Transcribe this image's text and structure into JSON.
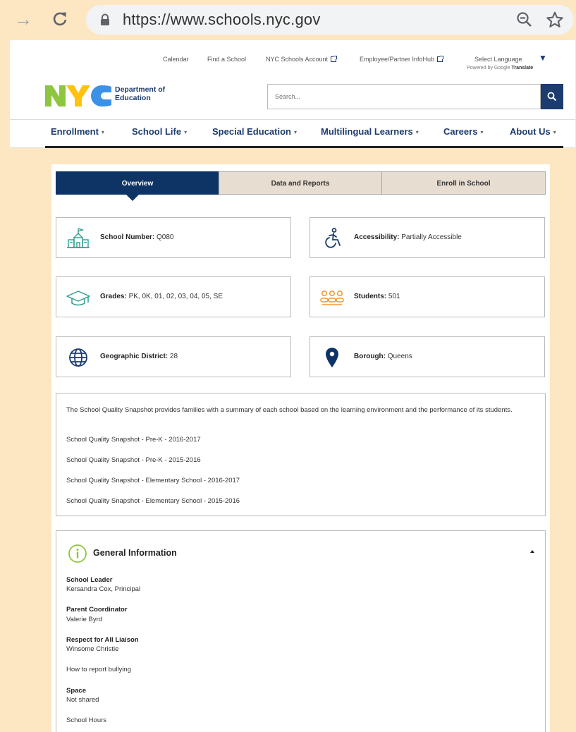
{
  "browser": {
    "url": "https://www.schools.nyc.gov",
    "back_icon": "arrow-right-icon",
    "reload_icon": "reload-icon",
    "lock_icon": "lock-icon",
    "zoom_icon": "zoom-out-icon",
    "star_icon": "star-icon"
  },
  "header": {
    "utility_links": [
      "Calendar",
      "Find a School",
      "NYC Schools Account",
      "Employee/Partner InfoHub",
      "Select Language"
    ],
    "powered_by": "Powered by",
    "google": "Google",
    "translate": "Translate",
    "logo_text": "NYC",
    "logo_dept": "Department of",
    "logo_edu": "Education",
    "search_placeholder": "Search...",
    "colors": {
      "nyc_green": "#8ec63f",
      "nyc_yellow": "#ffc20e",
      "nyc_blue": "#3c91e6",
      "navy": "#1d3c6e"
    }
  },
  "nav": {
    "items": [
      "Enrollment",
      "School Life",
      "Special Education",
      "Multilingual Learners",
      "Careers",
      "About Us"
    ]
  },
  "tabs": [
    "Overview",
    "Data and Reports",
    "Enroll in School"
  ],
  "cards": [
    {
      "label": "School Number:",
      "value": "Q080",
      "icon": "school-building-icon"
    },
    {
      "label": "Accessibility:",
      "value": "Partially Accessible",
      "icon": "wheelchair-icon"
    },
    {
      "label": "Grades:",
      "value": "PK, 0K, 01, 02, 03, 04, 05, SE",
      "icon": "graduation-cap-icon"
    },
    {
      "label": "Students:",
      "value": "501",
      "icon": "students-icon"
    },
    {
      "label": "Geographic District:",
      "value": "28",
      "icon": "globe-icon"
    },
    {
      "label": "Borough:",
      "value": "Queens",
      "icon": "map-pin-icon"
    }
  ],
  "snapshot": {
    "description": "The School Quality Snapshot provides families with a summary of each school based on the learning environment and the performance of its students.",
    "links": [
      "School Quality Snapshot - Pre-K - 2016-2017",
      "School Quality Snapshot - Pre-K - 2015-2016",
      "School Quality Snapshot - Elementary School - 2016-2017",
      "School Quality Snapshot - Elementary School - 2015-2016"
    ]
  },
  "general": {
    "title": "General Information",
    "icon": "info-icon",
    "school_leader_label": "School Leader",
    "school_leader": "Kersandra Cox, Principal",
    "parent_coordinator_label": "Parent Coordinator",
    "parent_coordinator": "Valerie Byrd",
    "respect_label": "Respect for All Liaison",
    "respect": "Winsome Christie",
    "bullying_link": "How to report bullying",
    "space_label": "Space",
    "space": "Not shared",
    "hours_link": "School Hours"
  }
}
